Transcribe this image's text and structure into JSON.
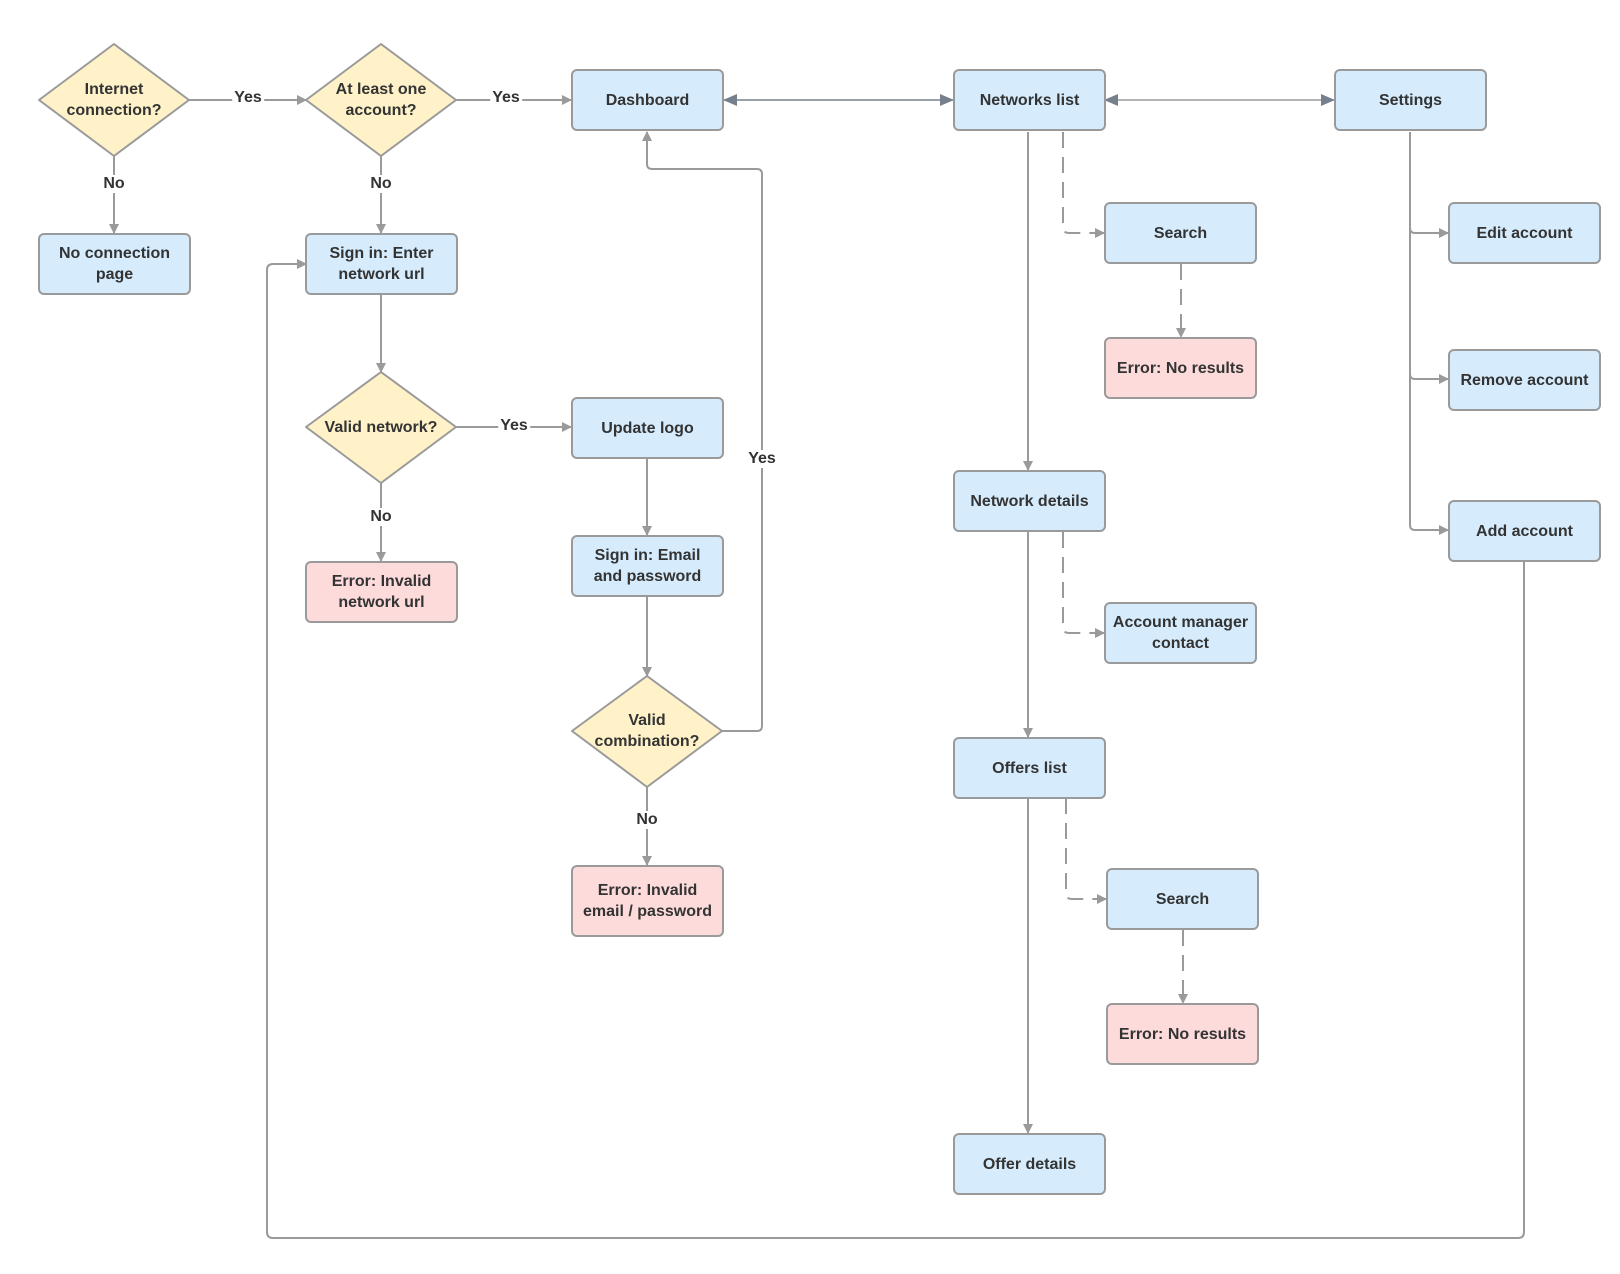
{
  "diagram": {
    "type": "flowchart",
    "colors": {
      "process_fill": "#d6ecfd",
      "decision_fill": "#fff2c9",
      "error_fill": "#fddbdb",
      "stroke": "#9a9a9a",
      "nav_edge": "#76808c",
      "text": "#333333"
    },
    "nodes": {
      "internet_connection": "Internet connection?",
      "at_least_one_account": "At least one account?",
      "dashboard": "Dashboard",
      "networks_list": "Networks list",
      "settings": "Settings",
      "no_connection_page": "No connection page",
      "sign_in_url": "Sign in: Enter network url",
      "valid_network": "Valid network?",
      "update_logo": "Update logo",
      "error_invalid_url": "Error: Invalid network url",
      "sign_in_email": "Sign in: Email and password",
      "valid_combination": "Valid combination?",
      "error_invalid_email": "Error: Invalid email / password",
      "search_networks": "Search",
      "error_no_results_1": "Error: No results",
      "network_details": "Network details",
      "account_manager_contact": "Account manager contact",
      "offers_list": "Offers list",
      "search_offers": "Search",
      "error_no_results_2": "Error: No results",
      "offer_details": "Offer details",
      "edit_account": "Edit account",
      "remove_account": "Remove account",
      "add_account": "Add account"
    },
    "edge_labels": {
      "internet_yes": "Yes",
      "internet_no": "No",
      "account_yes": "Yes",
      "account_no": "No",
      "network_yes": "Yes",
      "network_no": "No",
      "combination_yes": "Yes",
      "combination_no": "No"
    }
  }
}
